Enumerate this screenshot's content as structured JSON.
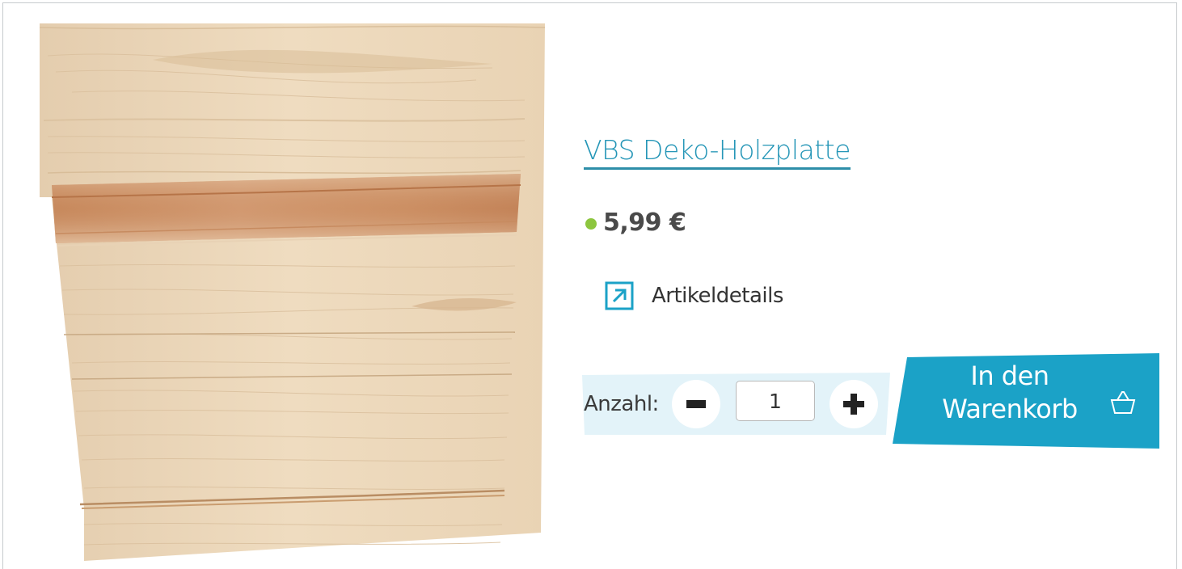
{
  "product": {
    "title": "VBS Deko-Holzplatte",
    "price": "5,99 €",
    "availability_color": "#8dc63f",
    "image_icon": "wooden-board-photo"
  },
  "details": {
    "label": "Artikeldetails",
    "icon": "external-link-arrow-icon"
  },
  "quantity": {
    "label": "Anzahl:",
    "value": "1",
    "minus_icon": "minus-icon",
    "plus_icon": "plus-icon"
  },
  "cart": {
    "label": "In den Warenkorb",
    "icon": "basket-icon",
    "color": "#1ba2c7"
  },
  "colors": {
    "accent": "#2596b7",
    "panel": "#e3f3f9",
    "text": "#333333"
  }
}
